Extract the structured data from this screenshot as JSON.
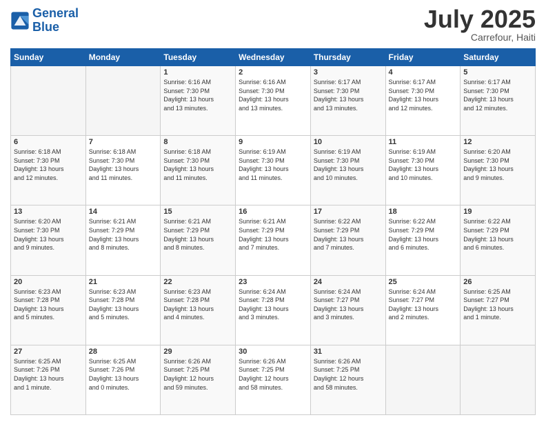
{
  "header": {
    "logo_line1": "General",
    "logo_line2": "Blue",
    "month": "July 2025",
    "location": "Carrefour, Haiti"
  },
  "days_of_week": [
    "Sunday",
    "Monday",
    "Tuesday",
    "Wednesday",
    "Thursday",
    "Friday",
    "Saturday"
  ],
  "weeks": [
    [
      {
        "num": "",
        "info": ""
      },
      {
        "num": "",
        "info": ""
      },
      {
        "num": "1",
        "info": "Sunrise: 6:16 AM\nSunset: 7:30 PM\nDaylight: 13 hours\nand 13 minutes."
      },
      {
        "num": "2",
        "info": "Sunrise: 6:16 AM\nSunset: 7:30 PM\nDaylight: 13 hours\nand 13 minutes."
      },
      {
        "num": "3",
        "info": "Sunrise: 6:17 AM\nSunset: 7:30 PM\nDaylight: 13 hours\nand 13 minutes."
      },
      {
        "num": "4",
        "info": "Sunrise: 6:17 AM\nSunset: 7:30 PM\nDaylight: 13 hours\nand 12 minutes."
      },
      {
        "num": "5",
        "info": "Sunrise: 6:17 AM\nSunset: 7:30 PM\nDaylight: 13 hours\nand 12 minutes."
      }
    ],
    [
      {
        "num": "6",
        "info": "Sunrise: 6:18 AM\nSunset: 7:30 PM\nDaylight: 13 hours\nand 12 minutes."
      },
      {
        "num": "7",
        "info": "Sunrise: 6:18 AM\nSunset: 7:30 PM\nDaylight: 13 hours\nand 11 minutes."
      },
      {
        "num": "8",
        "info": "Sunrise: 6:18 AM\nSunset: 7:30 PM\nDaylight: 13 hours\nand 11 minutes."
      },
      {
        "num": "9",
        "info": "Sunrise: 6:19 AM\nSunset: 7:30 PM\nDaylight: 13 hours\nand 11 minutes."
      },
      {
        "num": "10",
        "info": "Sunrise: 6:19 AM\nSunset: 7:30 PM\nDaylight: 13 hours\nand 10 minutes."
      },
      {
        "num": "11",
        "info": "Sunrise: 6:19 AM\nSunset: 7:30 PM\nDaylight: 13 hours\nand 10 minutes."
      },
      {
        "num": "12",
        "info": "Sunrise: 6:20 AM\nSunset: 7:30 PM\nDaylight: 13 hours\nand 9 minutes."
      }
    ],
    [
      {
        "num": "13",
        "info": "Sunrise: 6:20 AM\nSunset: 7:30 PM\nDaylight: 13 hours\nand 9 minutes."
      },
      {
        "num": "14",
        "info": "Sunrise: 6:21 AM\nSunset: 7:29 PM\nDaylight: 13 hours\nand 8 minutes."
      },
      {
        "num": "15",
        "info": "Sunrise: 6:21 AM\nSunset: 7:29 PM\nDaylight: 13 hours\nand 8 minutes."
      },
      {
        "num": "16",
        "info": "Sunrise: 6:21 AM\nSunset: 7:29 PM\nDaylight: 13 hours\nand 7 minutes."
      },
      {
        "num": "17",
        "info": "Sunrise: 6:22 AM\nSunset: 7:29 PM\nDaylight: 13 hours\nand 7 minutes."
      },
      {
        "num": "18",
        "info": "Sunrise: 6:22 AM\nSunset: 7:29 PM\nDaylight: 13 hours\nand 6 minutes."
      },
      {
        "num": "19",
        "info": "Sunrise: 6:22 AM\nSunset: 7:29 PM\nDaylight: 13 hours\nand 6 minutes."
      }
    ],
    [
      {
        "num": "20",
        "info": "Sunrise: 6:23 AM\nSunset: 7:28 PM\nDaylight: 13 hours\nand 5 minutes."
      },
      {
        "num": "21",
        "info": "Sunrise: 6:23 AM\nSunset: 7:28 PM\nDaylight: 13 hours\nand 5 minutes."
      },
      {
        "num": "22",
        "info": "Sunrise: 6:23 AM\nSunset: 7:28 PM\nDaylight: 13 hours\nand 4 minutes."
      },
      {
        "num": "23",
        "info": "Sunrise: 6:24 AM\nSunset: 7:28 PM\nDaylight: 13 hours\nand 3 minutes."
      },
      {
        "num": "24",
        "info": "Sunrise: 6:24 AM\nSunset: 7:27 PM\nDaylight: 13 hours\nand 3 minutes."
      },
      {
        "num": "25",
        "info": "Sunrise: 6:24 AM\nSunset: 7:27 PM\nDaylight: 13 hours\nand 2 minutes."
      },
      {
        "num": "26",
        "info": "Sunrise: 6:25 AM\nSunset: 7:27 PM\nDaylight: 13 hours\nand 1 minute."
      }
    ],
    [
      {
        "num": "27",
        "info": "Sunrise: 6:25 AM\nSunset: 7:26 PM\nDaylight: 13 hours\nand 1 minute."
      },
      {
        "num": "28",
        "info": "Sunrise: 6:25 AM\nSunset: 7:26 PM\nDaylight: 13 hours\nand 0 minutes."
      },
      {
        "num": "29",
        "info": "Sunrise: 6:26 AM\nSunset: 7:25 PM\nDaylight: 12 hours\nand 59 minutes."
      },
      {
        "num": "30",
        "info": "Sunrise: 6:26 AM\nSunset: 7:25 PM\nDaylight: 12 hours\nand 58 minutes."
      },
      {
        "num": "31",
        "info": "Sunrise: 6:26 AM\nSunset: 7:25 PM\nDaylight: 12 hours\nand 58 minutes."
      },
      {
        "num": "",
        "info": ""
      },
      {
        "num": "",
        "info": ""
      }
    ]
  ]
}
